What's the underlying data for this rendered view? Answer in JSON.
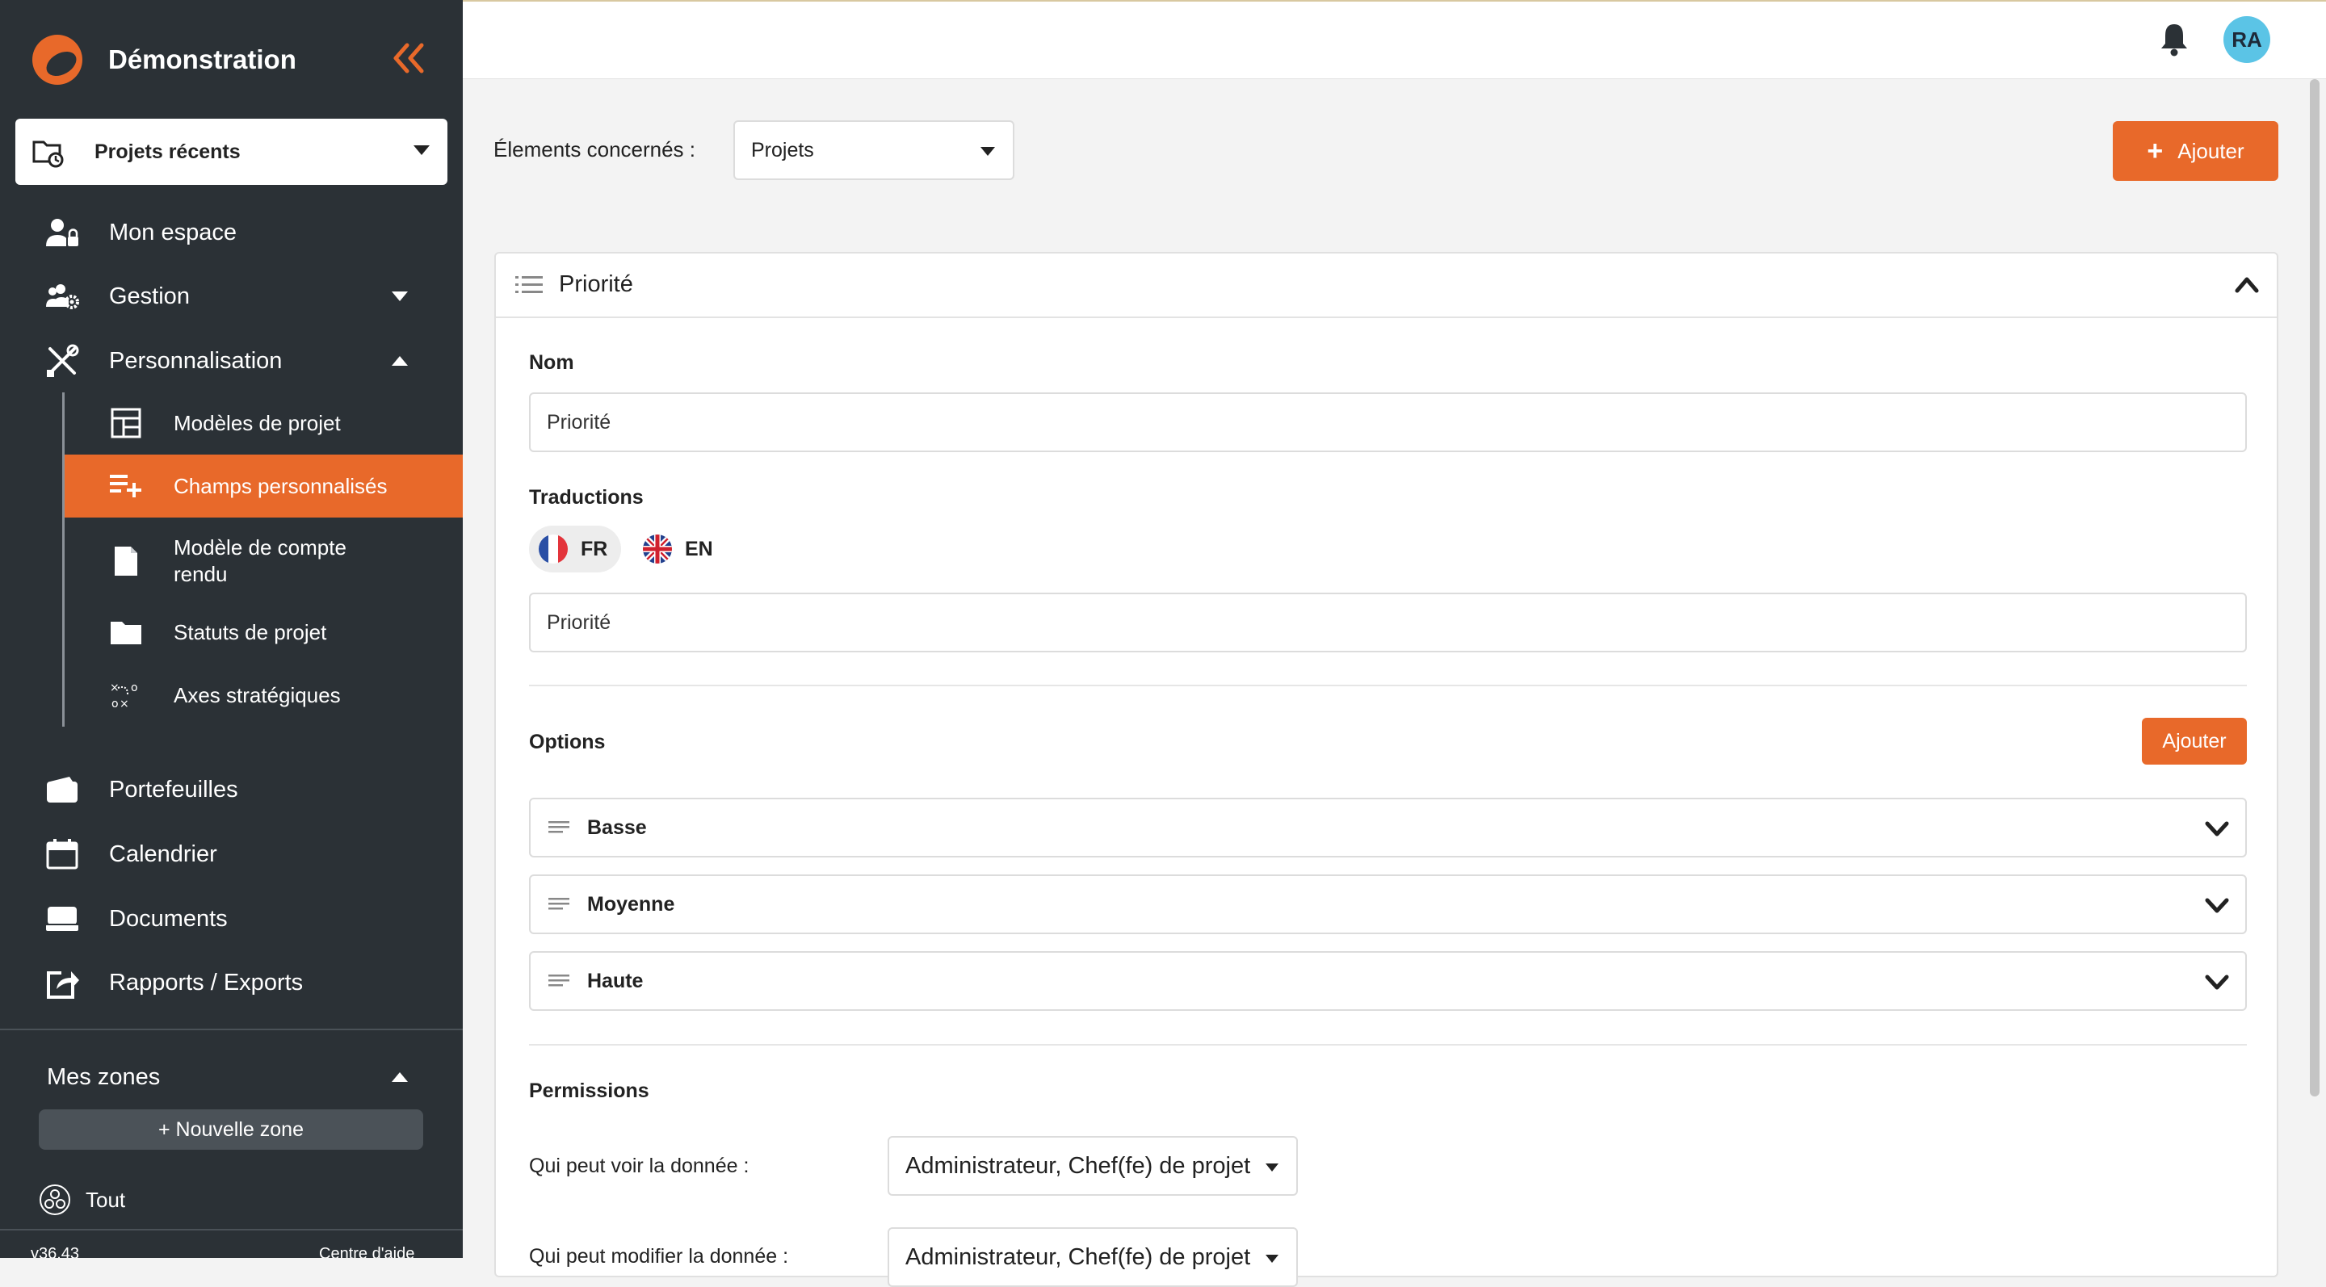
{
  "brand": {
    "name": "Démonstration"
  },
  "recent_projects": {
    "label": "Projets récents"
  },
  "nav": {
    "mon_espace": "Mon espace",
    "gestion": "Gestion",
    "personnalisation": "Personnalisation",
    "portefeuilles": "Portefeuilles",
    "calendrier": "Calendrier",
    "documents": "Documents",
    "rapports": "Rapports / Exports"
  },
  "subnav": {
    "modeles_projet": "Modèles de projet",
    "champs_personnalises": "Champs personnalisés",
    "modele_compte_rendu": "Modèle de compte rendu",
    "statuts_projet": "Statuts de projet",
    "axes_strategiques": "Axes stratégiques"
  },
  "zones": {
    "title": "Mes zones",
    "new_zone": "+ Nouvelle zone",
    "all": "Tout"
  },
  "footer": {
    "version": "v36.43",
    "help": "Centre d'aide"
  },
  "user": {
    "initials": "RA"
  },
  "filter": {
    "label": "Élements concernés :",
    "value": "Projets"
  },
  "add_button": {
    "label": "Ajouter"
  },
  "panel": {
    "title": "Priorité",
    "name_label": "Nom",
    "name_value": "Priorité",
    "translations_label": "Traductions",
    "lang_fr": "FR",
    "lang_en": "EN",
    "translation_value": "Priorité",
    "options_label": "Options",
    "options_add": "Ajouter",
    "options": [
      "Basse",
      "Moyenne",
      "Haute"
    ],
    "permissions_label": "Permissions",
    "perm_view_label": "Qui peut voir la donnée :",
    "perm_view_value": "Administrateur, Chef(fe) de projet",
    "perm_edit_label": "Qui peut modifier la donnée :",
    "perm_edit_value": "Administrateur, Chef(fe) de projet"
  },
  "colors": {
    "accent": "#e8692a",
    "sidebar": "#2b3136",
    "avatar": "#5bc4e6"
  }
}
